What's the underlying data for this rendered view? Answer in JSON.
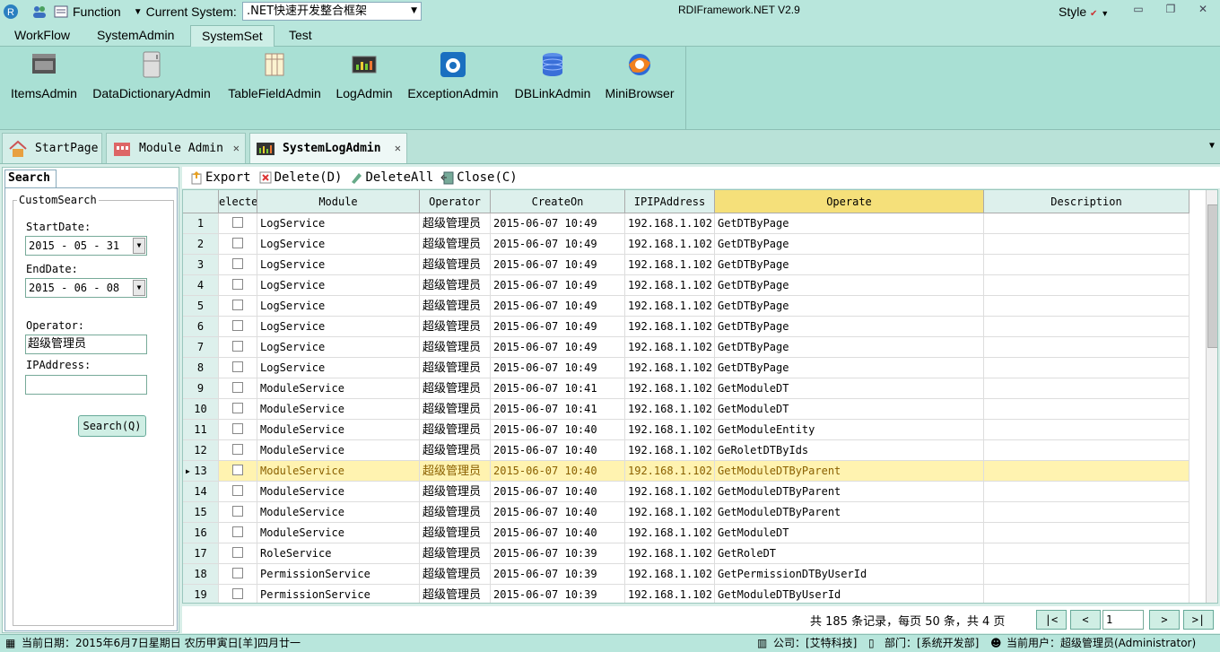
{
  "titlebar": {
    "function_label": "Function",
    "system_label": "Current System:",
    "system_value": ".NET快速开发整合框架",
    "app_title": "RDIFramework.NET V2.9",
    "style_label": "Style"
  },
  "menu": {
    "tabs": [
      "WorkFlow",
      "SystemAdmin",
      "SystemSet",
      "Test"
    ],
    "active": "SystemSet"
  },
  "ribbon": [
    {
      "label": "ItemsAdmin",
      "icon": "film-icon"
    },
    {
      "label": "DataDictionaryAdmin",
      "icon": "fridge-icon"
    },
    {
      "label": "TableFieldAdmin",
      "icon": "table-icon"
    },
    {
      "label": "LogAdmin",
      "icon": "log-monitor-icon"
    },
    {
      "label": "ExceptionAdmin",
      "icon": "exception-icon"
    },
    {
      "label": "DBLinkAdmin",
      "icon": "database-icon"
    },
    {
      "label": "MiniBrowser",
      "icon": "browser-icon"
    }
  ],
  "doctabs": [
    {
      "label": "StartPage",
      "icon": "home-icon"
    },
    {
      "label": "Module Admin",
      "icon": "module-icon"
    },
    {
      "label": "SystemLogAdmin",
      "icon": "log-icon"
    }
  ],
  "search": {
    "tab": "Search",
    "legend": "CustomSearch",
    "start_label": "StartDate:",
    "start_value": "2015 - 05 - 31",
    "end_label": "EndDate:",
    "end_value": "2015 - 06 - 08",
    "operator_label": "Operator:",
    "operator_value": "超级管理员",
    "ip_label": "IPAddress:",
    "ip_value": "",
    "button": "Search(Q)"
  },
  "toolbar": {
    "export": "Export",
    "delete": "Delete(D)",
    "delete_all": "DeleteAll",
    "close": "Close(C)"
  },
  "grid": {
    "columns": [
      "electe",
      "Module",
      "Operator",
      "CreateOn",
      "IPIPAddress",
      "Operate",
      "Description"
    ],
    "rows": [
      [
        "1",
        "LogService",
        "超级管理员",
        "2015-06-07 10:49",
        "192.168.1.102",
        "GetDTByPage",
        ""
      ],
      [
        "2",
        "LogService",
        "超级管理员",
        "2015-06-07 10:49",
        "192.168.1.102",
        "GetDTByPage",
        ""
      ],
      [
        "3",
        "LogService",
        "超级管理员",
        "2015-06-07 10:49",
        "192.168.1.102",
        "GetDTByPage",
        ""
      ],
      [
        "4",
        "LogService",
        "超级管理员",
        "2015-06-07 10:49",
        "192.168.1.102",
        "GetDTByPage",
        ""
      ],
      [
        "5",
        "LogService",
        "超级管理员",
        "2015-06-07 10:49",
        "192.168.1.102",
        "GetDTByPage",
        ""
      ],
      [
        "6",
        "LogService",
        "超级管理员",
        "2015-06-07 10:49",
        "192.168.1.102",
        "GetDTByPage",
        ""
      ],
      [
        "7",
        "LogService",
        "超级管理员",
        "2015-06-07 10:49",
        "192.168.1.102",
        "GetDTByPage",
        ""
      ],
      [
        "8",
        "LogService",
        "超级管理员",
        "2015-06-07 10:49",
        "192.168.1.102",
        "GetDTByPage",
        ""
      ],
      [
        "9",
        "ModuleService",
        "超级管理员",
        "2015-06-07 10:41",
        "192.168.1.102",
        "GetModuleDT",
        ""
      ],
      [
        "10",
        "ModuleService",
        "超级管理员",
        "2015-06-07 10:41",
        "192.168.1.102",
        "GetModuleDT",
        ""
      ],
      [
        "11",
        "ModuleService",
        "超级管理员",
        "2015-06-07 10:40",
        "192.168.1.102",
        "GetModuleEntity",
        ""
      ],
      [
        "12",
        "ModuleService",
        "超级管理员",
        "2015-06-07 10:40",
        "192.168.1.102",
        "GeRoletDTByIds",
        ""
      ],
      [
        "13",
        "ModuleService",
        "超级管理员",
        "2015-06-07 10:40",
        "192.168.1.102",
        "GetModuleDTByParent",
        ""
      ],
      [
        "14",
        "ModuleService",
        "超级管理员",
        "2015-06-07 10:40",
        "192.168.1.102",
        "GetModuleDTByParent",
        ""
      ],
      [
        "15",
        "ModuleService",
        "超级管理员",
        "2015-06-07 10:40",
        "192.168.1.102",
        "GetModuleDTByParent",
        ""
      ],
      [
        "16",
        "ModuleService",
        "超级管理员",
        "2015-06-07 10:40",
        "192.168.1.102",
        "GetModuleDT",
        ""
      ],
      [
        "17",
        "RoleService",
        "超级管理员",
        "2015-06-07 10:39",
        "192.168.1.102",
        "GetRoleDT",
        ""
      ],
      [
        "18",
        "PermissionService",
        "超级管理员",
        "2015-06-07 10:39",
        "192.168.1.102",
        "GetPermissionDTByUserId",
        ""
      ],
      [
        "19",
        "PermissionService",
        "超级管理员",
        "2015-06-07 10:39",
        "192.168.1.102",
        "GetModuleDTByUserId",
        ""
      ]
    ],
    "current_row": 13
  },
  "pager": {
    "info": "共 185 条记录，每页 50 条，共 4 页",
    "page": "1",
    "first": "|<",
    "prev": "<",
    "next": ">",
    "last": ">|"
  },
  "status": {
    "date": "当前日期：2015年6月7日星期日 农历甲寅日[羊]四月廿一",
    "company": "公司：[艾特科技]",
    "dept": "部门：[系统开发部]",
    "user": "当前用户：超级管理员(Administrator)"
  },
  "colors": {
    "accent": "#b8e6dc",
    "selected_row": "#fff3b0",
    "selected_header": "#f5e07a"
  }
}
